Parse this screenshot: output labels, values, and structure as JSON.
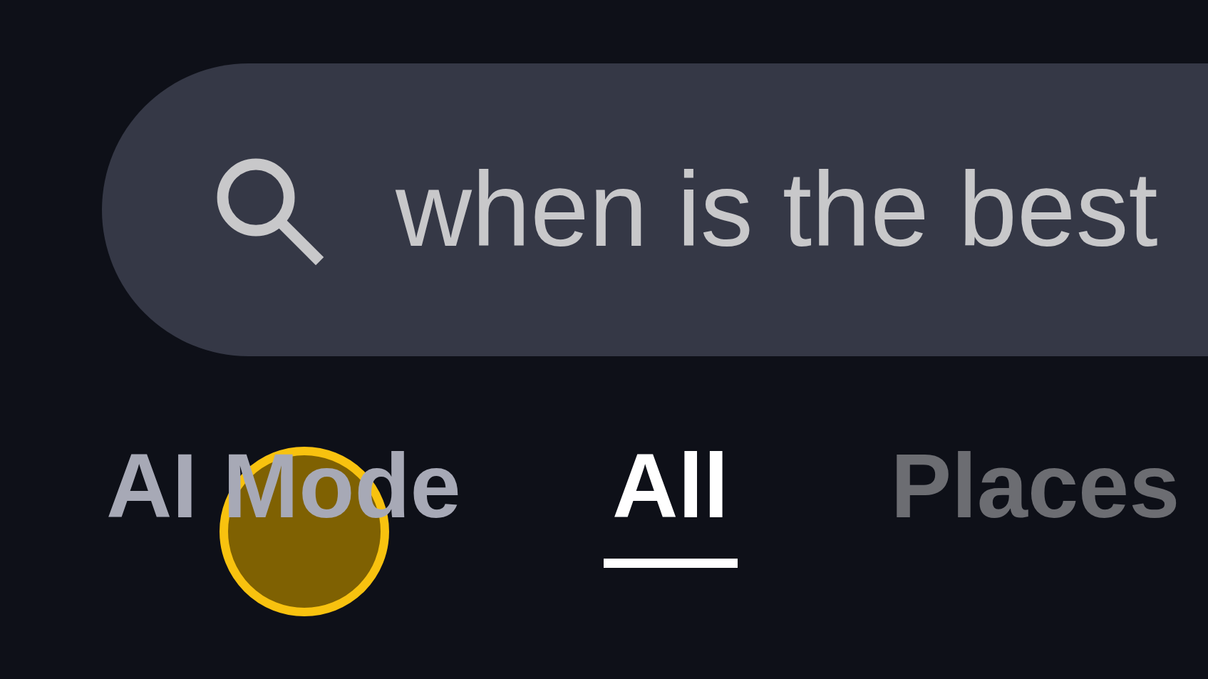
{
  "search": {
    "value": "when is the best"
  },
  "tabs": [
    {
      "label": "AI Mode",
      "selected": false,
      "faded": false,
      "tapped": true
    },
    {
      "label": "All",
      "selected": true,
      "faded": false,
      "tapped": false
    },
    {
      "label": "Places",
      "selected": false,
      "faded": true,
      "tapped": false
    }
  ]
}
